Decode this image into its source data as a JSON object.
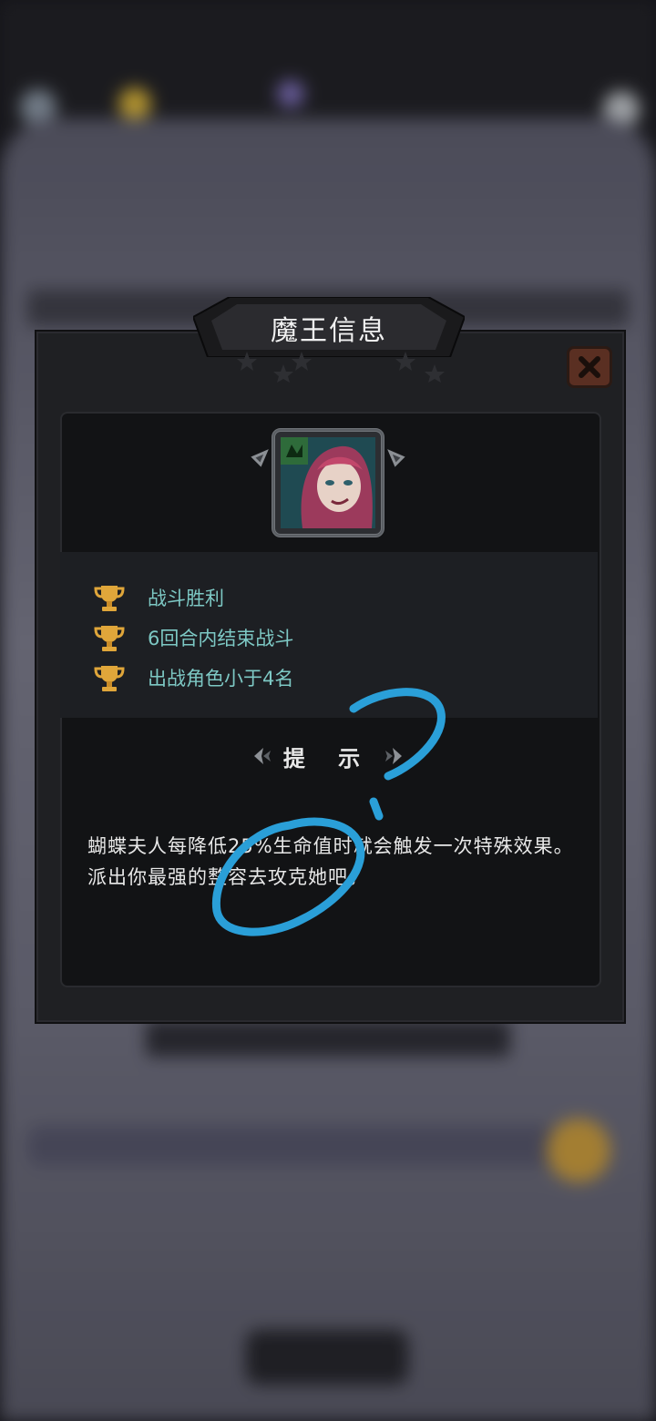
{
  "modal": {
    "title": "魔王信息",
    "goals": [
      {
        "icon": "trophy-icon",
        "text": "战斗胜利"
      },
      {
        "icon": "trophy-icon",
        "text": "6回合内结束战斗"
      },
      {
        "icon": "trophy-icon",
        "text": "出战角色小于4名"
      }
    ],
    "hint_title": "提 示",
    "hint_text": "蝴蝶夫人每降低25%生命值时就会触发一次特殊效果。派出你最强的整容去攻克她吧。"
  },
  "colors": {
    "goal_text": "#7dc8c4",
    "annotation": "#2a9fd8",
    "close_button": "#5a2f22"
  }
}
